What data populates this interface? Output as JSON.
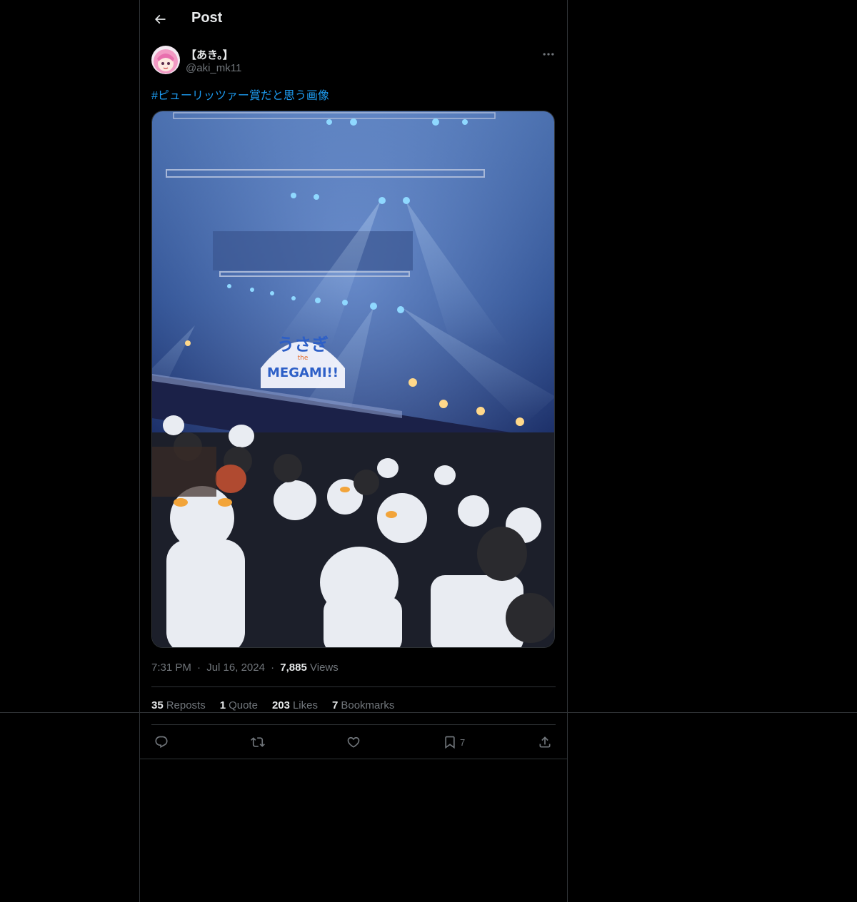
{
  "header": {
    "title": "Post",
    "back_icon": "arrow-left-icon"
  },
  "author": {
    "display_name": "【あき。】",
    "handle": "@aki_mk11",
    "avatar_icon": "avatar-anime-girl"
  },
  "tweet": {
    "text": "#ピューリッツァー賞だと思う画像",
    "media": {
      "banner_line1": "うさぎ",
      "banner_line2": "the",
      "banner_line3": "MEGAMI!!"
    }
  },
  "meta": {
    "time": "7:31 PM",
    "separator": "·",
    "date": "Jul 16, 2024",
    "views_count": "7,885",
    "views_label": "Views"
  },
  "stats": [
    {
      "count": "35",
      "label": "Reposts"
    },
    {
      "count": "1",
      "label": "Quote"
    },
    {
      "count": "203",
      "label": "Likes"
    },
    {
      "count": "7",
      "label": "Bookmarks"
    }
  ],
  "actions": {
    "reply_icon": "reply-icon",
    "repost_icon": "repost-icon",
    "like_icon": "heart-icon",
    "bookmark_icon": "bookmark-icon",
    "bookmark_count": "7",
    "share_icon": "share-icon"
  },
  "colors": {
    "background": "#000000",
    "text_primary": "#e7e9ea",
    "text_secondary": "#71767b",
    "accent": "#1d9bf0",
    "border": "#2f3336"
  }
}
